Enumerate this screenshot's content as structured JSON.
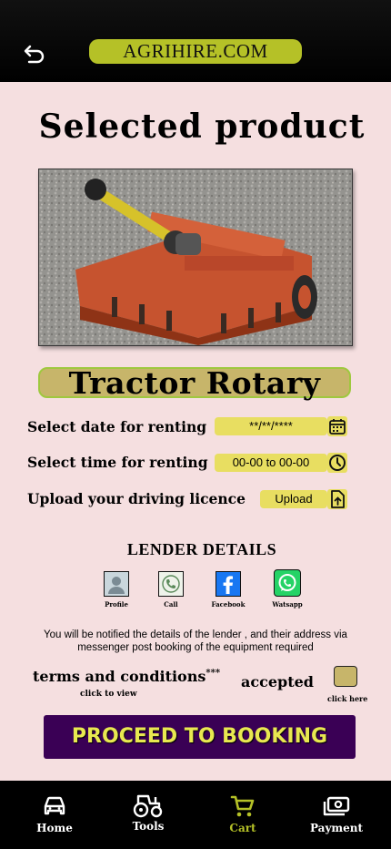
{
  "header": {
    "back_icon": "back-arrow-icon",
    "brand": "AGRIHIRE.COM"
  },
  "page_title": "Selected product",
  "product": {
    "name": "Tractor Rotary"
  },
  "form": {
    "date_label": "Select date for renting",
    "date_value": "**/**/****",
    "date_icon": "calendar-icon",
    "time_label": "Select time for renting",
    "time_value": "00-00 to 00-00",
    "time_icon": "clock-icon",
    "licence_label": "Upload your driving licence",
    "licence_button": "Upload",
    "licence_icon": "upload-file-icon"
  },
  "lender": {
    "title": "LENDER DETAILS",
    "contacts": [
      {
        "label": "Profile",
        "icon": "profile-icon"
      },
      {
        "label": "Call",
        "icon": "phone-icon"
      },
      {
        "label": "Facebook",
        "icon": "facebook-icon"
      },
      {
        "label": "Watsapp",
        "icon": "whatsapp-icon"
      }
    ]
  },
  "notice": "You will be notified the details of the lender , and their address via messenger post booking of the equipment required",
  "terms": {
    "text": "terms and conditions",
    "mark": "***",
    "click_to_view": "click to view",
    "accepted": "accepted",
    "click_here": "click here"
  },
  "proceed_button": "PROCEED TO BOOKING",
  "bottom_nav": [
    {
      "label": "Home",
      "icon": "car-icon",
      "active": false
    },
    {
      "label": "Tools",
      "icon": "tractor-icon",
      "active": false
    },
    {
      "label": "Cart",
      "icon": "cart-icon",
      "active": true
    },
    {
      "label": "Payment",
      "icon": "money-icon",
      "active": false
    }
  ],
  "colors": {
    "accent": "#b5c127",
    "background": "#f5dfe0",
    "button": "#3a0055",
    "field": "#e8de61"
  }
}
